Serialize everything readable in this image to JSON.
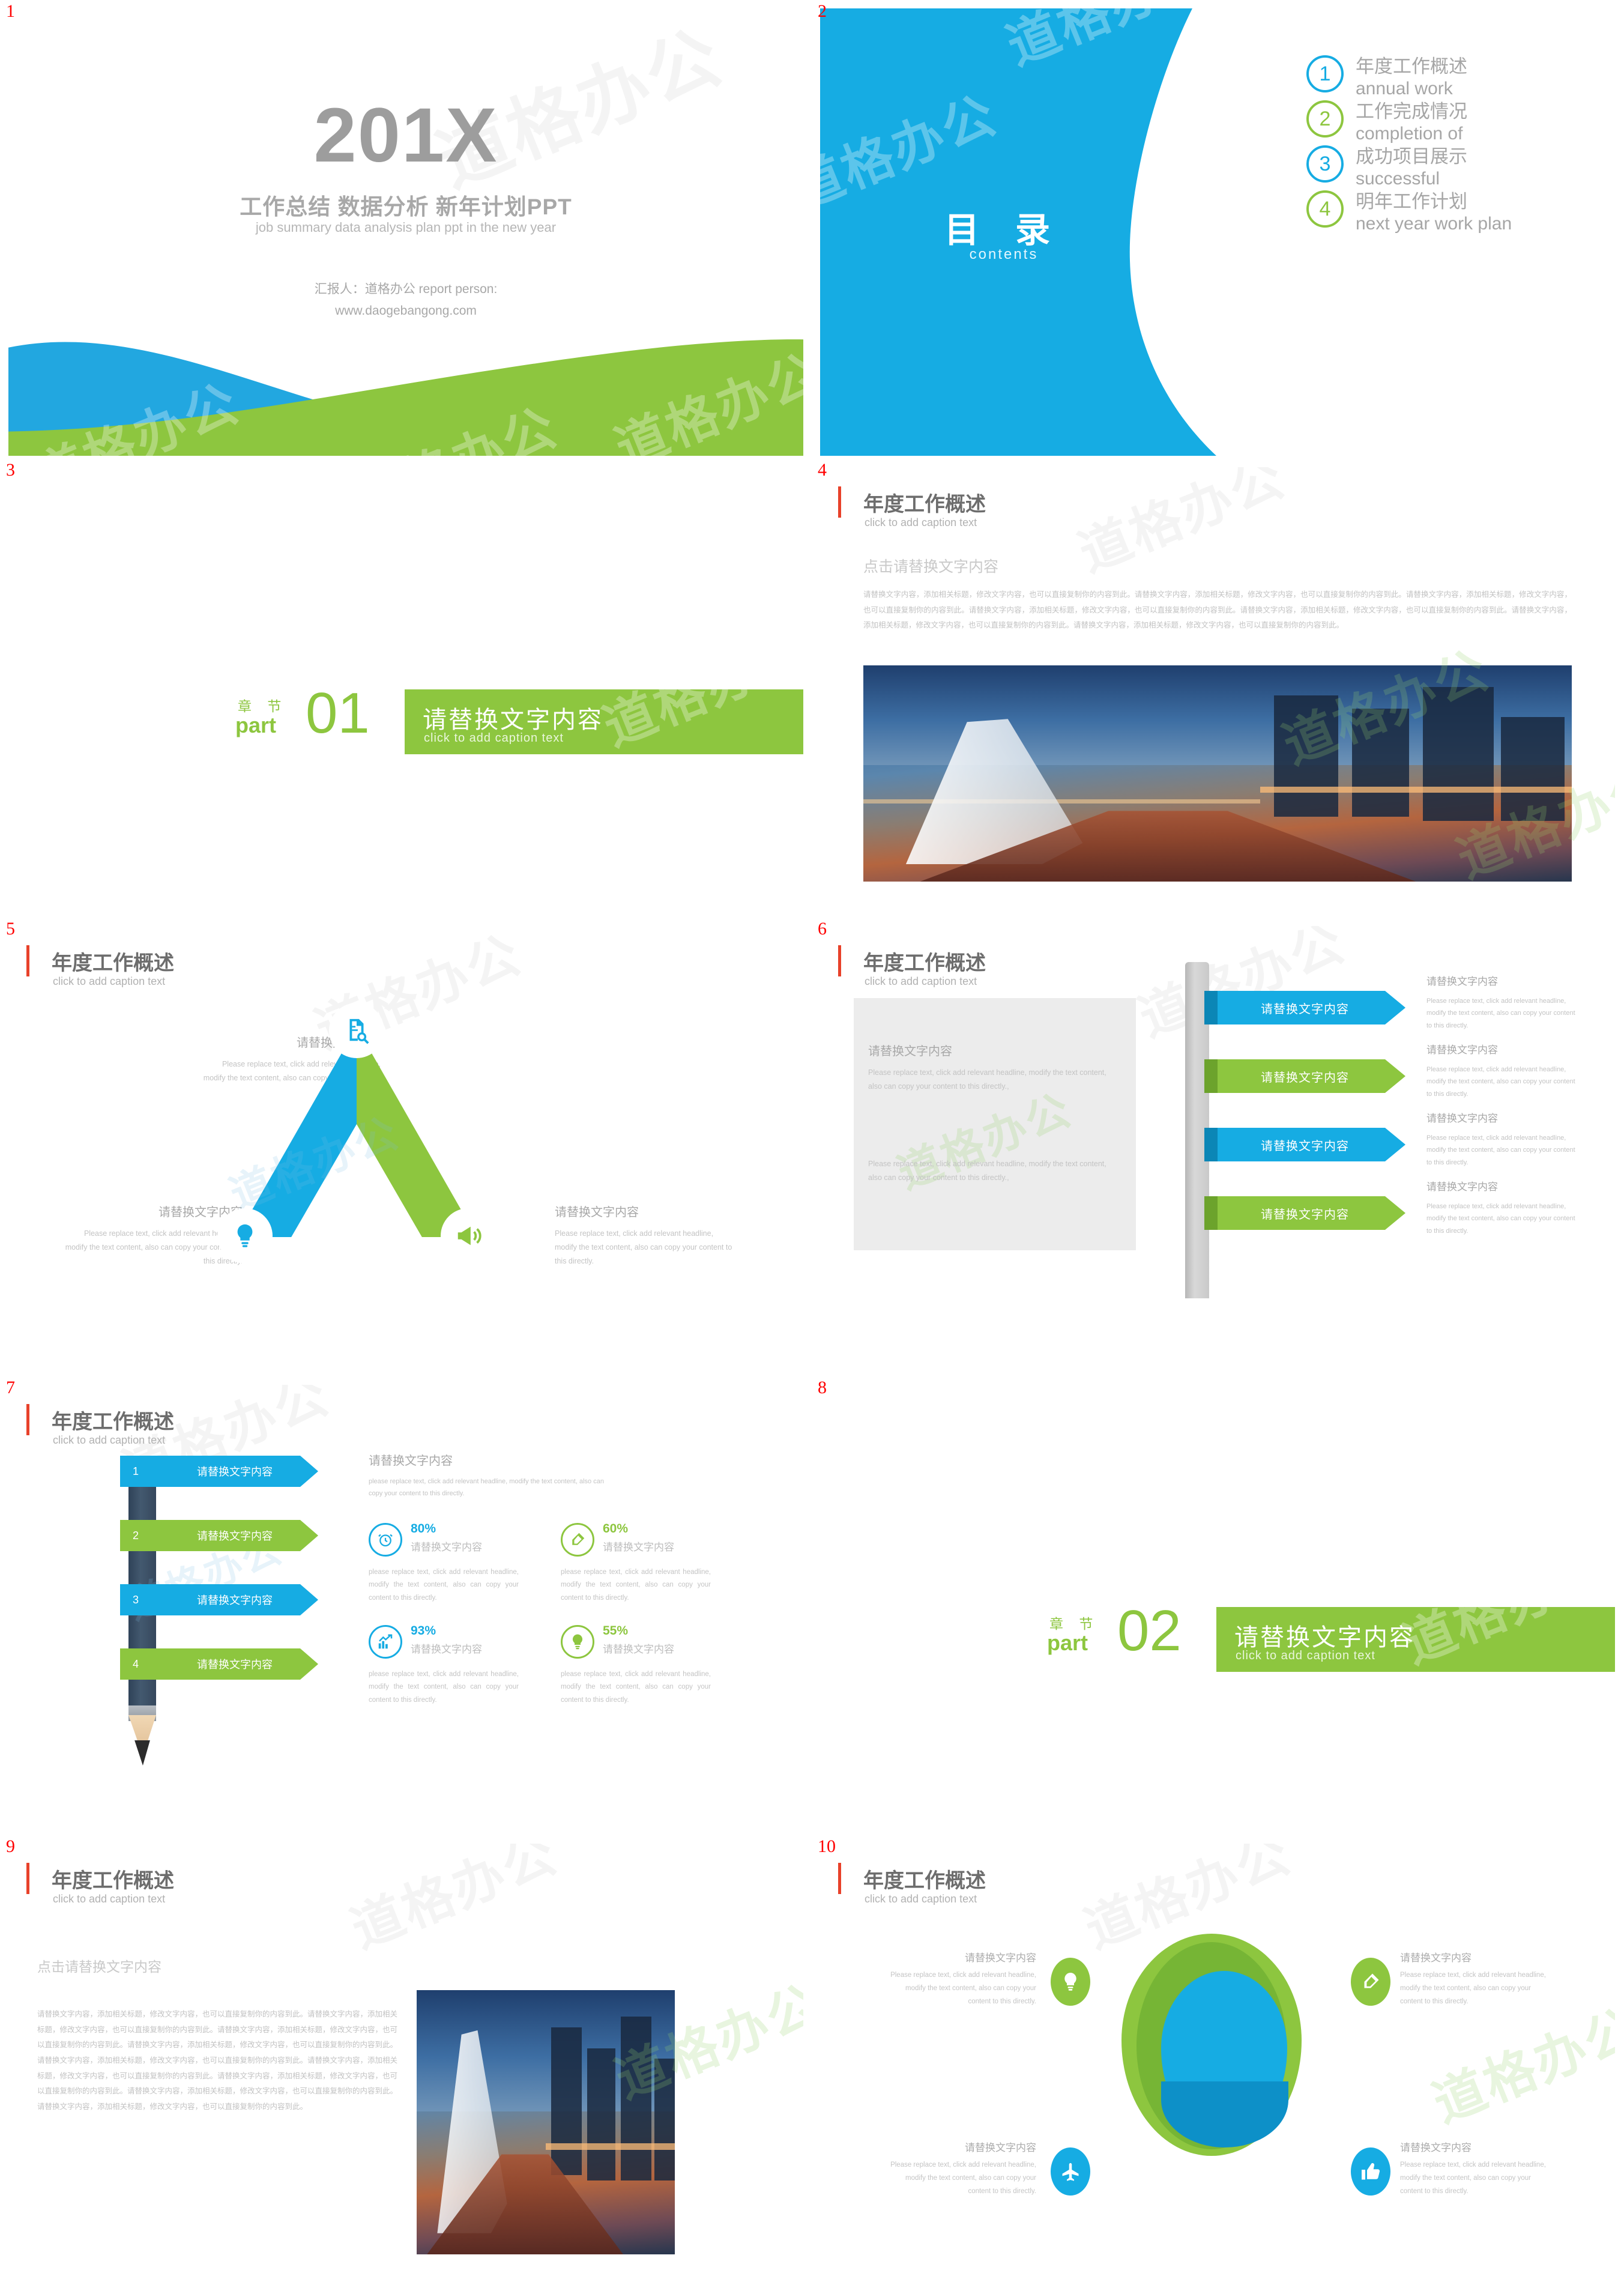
{
  "deck": {
    "accent_blue": "#16ace3",
    "accent_green": "#8dc63f",
    "slide_number_color": "#ff0000",
    "watermark_text": "道格办公"
  },
  "slides": [
    {
      "number": "1",
      "name": "cover",
      "title": "201X",
      "subtitle_cn": "工作总结 数据分析 新年计划PPT",
      "subtitle_en": "job summary  data analysis plan ppt in the new year",
      "reporter": "汇报人：道格办公 report person:",
      "website": "www.daogebangong.com"
    },
    {
      "number": "2",
      "name": "table-of-contents",
      "heading_cn": "目 录",
      "heading_en": "contents",
      "items": [
        {
          "num": "1",
          "cn": "年度工作概述",
          "en": "annual work",
          "color": "#16ace3"
        },
        {
          "num": "2",
          "cn": "工作完成情况",
          "en": "completion of",
          "color": "#8dc63f"
        },
        {
          "num": "3",
          "cn": "成功项目展示",
          "en": "successful",
          "color": "#16ace3"
        },
        {
          "num": "4",
          "cn": "明年工作计划",
          "en": "next year work plan",
          "color": "#8dc63f"
        }
      ]
    },
    {
      "number": "3",
      "name": "section-divider-01",
      "zhang": "章 节",
      "part": "part",
      "index": "01",
      "cn": "请替换文字内容",
      "en": "click to add caption text"
    },
    {
      "number": "4",
      "name": "annual-work-overview-text-photo",
      "header_cn": "年度工作概述",
      "header_en": "click to add caption text",
      "lead": "点击请替换文字内容",
      "paragraph": "请替换文字内容，添加相关标题，修改文字内容，也可以直接复制你的内容到此。请替换文字内容，添加相关标题，修改文字内容，也可以直接复制你的内容到此。请替换文字内容，添加相关标题，修改文字内容，也可以直接复制你的内容到此。请替换文字内容，添加相关标题，修改文字内容，也可以直接复制你的内容到此。请替换文字内容，添加相关标题，修改文字内容，也可以直接复制你的内容到此。请替换文字内容，添加相关标题，修改文字内容，也可以直接复制你的内容到此。请替换文字内容，添加相关标题，修改文字内容，也可以直接复制你的内容到此。"
    },
    {
      "number": "5",
      "name": "triangle-three-points",
      "header_cn": "年度工作概述",
      "header_en": "click to add caption text",
      "blocks": [
        {
          "title": "请替换文字内容",
          "desc": "Please replace text, click add relevant headline, modify the text content, also can copy your content to this directly.",
          "icon": "document-search-icon",
          "color": "#16ace3"
        },
        {
          "title": "请替换文字内容",
          "desc": "Please replace text, click add relevant headline, modify the text content, also can copy your content to this directly.",
          "icon": "lightbulb-icon",
          "color": "#16ace3"
        },
        {
          "title": "请替换文字内容",
          "desc": "Please replace text, click add relevant headline, modify the text content, also can copy your content to this directly.",
          "icon": "megaphone-icon",
          "color": "#8dc63f"
        }
      ]
    },
    {
      "number": "6",
      "name": "four-arrow-signposts",
      "header_cn": "年度工作概述",
      "header_en": "click to add caption text",
      "left_card": {
        "title": "请替换文字内容",
        "desc1": "Please replace text, click add relevant headline, modify the text content, also can copy your content to this directly.,",
        "desc2": "Please replace text, click add relevant headline, modify the text content, also can copy your content to this directly.,"
      },
      "rows": [
        {
          "arrow": "请替换文字内容",
          "title": "请替换文字内容",
          "desc": "Please replace text, click add relevant headline, modify the text content, also can copy your content to this directly.",
          "color": "#16ace3"
        },
        {
          "arrow": "请替换文字内容",
          "title": "请替换文字内容",
          "desc": "Please replace text, click add relevant headline, modify the text content, also can copy your content to this directly.",
          "color": "#8dc63f"
        },
        {
          "arrow": "请替换文字内容",
          "title": "请替换文字内容",
          "desc": "Please replace text, click add relevant headline, modify the text content, also can copy your content to this directly.",
          "color": "#16ace3"
        },
        {
          "arrow": "请替换文字内容",
          "title": "请替换文字内容",
          "desc": "Please replace text, click add relevant headline, modify the text content, also can copy your content to this directly.",
          "color": "#8dc63f"
        }
      ]
    },
    {
      "number": "7",
      "name": "pencil-list-and-stats",
      "header_cn": "年度工作概述",
      "header_en": "click to add caption text",
      "pencil_rows": [
        {
          "n": "1",
          "label": "请替换文字内容",
          "color": "#16ace3"
        },
        {
          "n": "2",
          "label": "请替换文字内容",
          "color": "#8dc63f"
        },
        {
          "n": "3",
          "label": "请替换文字内容",
          "color": "#16ace3"
        },
        {
          "n": "4",
          "label": "请替换文字内容",
          "color": "#8dc63f"
        }
      ],
      "right_title": "请替换文字内容",
      "right_desc": "please replace text, click add relevant headline, modify the text content, also can copy your content to this directly.",
      "stats": [
        {
          "pct": "80%",
          "label": "请替换文字内容",
          "desc": "please replace text, click add relevant headline, modify the text content, also can copy your content to this directly.",
          "icon": "alarm-clock-icon",
          "color": "#16ace3"
        },
        {
          "pct": "60%",
          "label": "请替换文字内容",
          "desc": "please replace text, click add relevant headline, modify the text content, also can copy your content to this directly.",
          "icon": "pen-nib-icon",
          "color": "#8dc63f"
        },
        {
          "pct": "93%",
          "label": "请替换文字内容",
          "desc": "please replace text, click add relevant headline, modify the text content, also can copy your content to this directly.",
          "icon": "growth-chart-icon",
          "color": "#16ace3"
        },
        {
          "pct": "55%",
          "label": "请替换文字内容",
          "desc": "please replace text, click add relevant headline, modify the text content, also can copy your content to this directly.",
          "icon": "lightbulb-icon",
          "color": "#8dc63f"
        }
      ]
    },
    {
      "number": "8",
      "name": "section-divider-02",
      "zhang": "章 节",
      "part": "part",
      "index": "02",
      "cn": "请替换文字内容",
      "en": "click to add caption text"
    },
    {
      "number": "9",
      "name": "text-and-photo",
      "header_cn": "年度工作概述",
      "header_en": "click to add caption text",
      "lead": "点击请替换文字内容",
      "paragraph": "请替换文字内容，添加相关标题，修改文字内容，也可以直接复制你的内容到此。请替换文字内容，添加相关标题，修改文字内容，也可以直接复制你的内容到此。请替换文字内容，添加相关标题，修改文字内容，也可以直接复制你的内容到此。请替换文字内容，添加相关标题，修改文字内容，也可以直接复制你的内容到此。请替换文字内容，添加相关标题，修改文字内容，也可以直接复制你的内容到此。请替换文字内容，添加相关标题，修改文字内容，也可以直接复制你的内容到此。请替换文字内容，添加相关标题，修改文字内容，也可以直接复制你的内容到此。请替换文字内容，添加相关标题，修改文字内容，也可以直接复制你的内容到此。请替换文字内容，添加相关标题，修改文字内容，也可以直接复制你的内容到此。"
    },
    {
      "number": "10",
      "name": "sphere-four-callouts",
      "header_cn": "年度工作概述",
      "header_en": "click to add caption text",
      "callouts": [
        {
          "title": "请替换文字内容",
          "desc": "Please replace text, click add relevant headline, modify the text content, also can copy your content to this directly.",
          "icon": "lightbulb-icon",
          "color": "#8dc63f"
        },
        {
          "title": "请替换文字内容",
          "desc": "Please replace text, click add relevant headline, modify the text content, also can copy your content to this directly.",
          "icon": "pen-nib-icon",
          "color": "#8dc63f"
        },
        {
          "title": "请替换文字内容",
          "desc": "Please replace text, click add relevant headline, modify the text content, also can copy your content to this directly.",
          "icon": "airplane-icon",
          "color": "#16ace3"
        },
        {
          "title": "请替换文字内容",
          "desc": "Please replace text, click add relevant headline, modify the text content, also can copy your content to this directly.",
          "icon": "thumbs-up-icon",
          "color": "#16ace3"
        }
      ]
    }
  ]
}
